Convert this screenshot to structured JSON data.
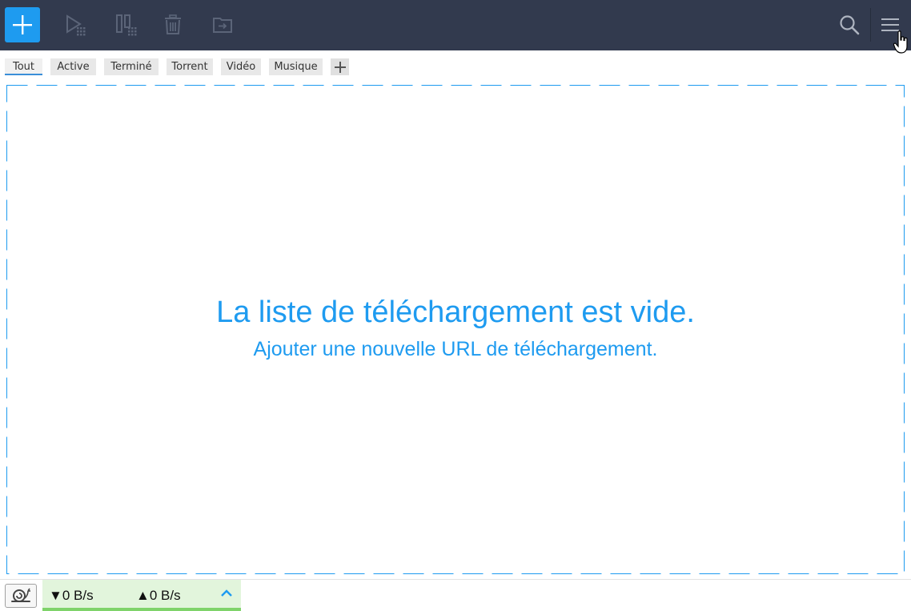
{
  "toolbar": {
    "icons": [
      "plus-icon",
      "play-icon",
      "pause-icon",
      "trash-icon",
      "move-folder-icon",
      "search-icon",
      "hamburger-menu-icon"
    ],
    "colors": {
      "background": "#323a4e",
      "accent": "#1e9bf0",
      "disabled_icon": "#5b6478",
      "active_icon": "#aeb4c0"
    }
  },
  "tabs": [
    {
      "label": "Tout",
      "active": true
    },
    {
      "label": "Active",
      "active": false
    },
    {
      "label": "Terminé",
      "active": false
    },
    {
      "label": "Torrent",
      "active": false
    },
    {
      "label": "Vidéo",
      "active": false
    },
    {
      "label": "Musique",
      "active": false
    }
  ],
  "empty_state": {
    "title": "La liste de téléchargement est vide.",
    "subtitle": "Ajouter une nouvelle URL de téléchargement."
  },
  "statusbar": {
    "download_speed": "0 B/s",
    "upload_speed": "0 B/s",
    "download_arrow": "▼",
    "upload_arrow": "▲"
  }
}
